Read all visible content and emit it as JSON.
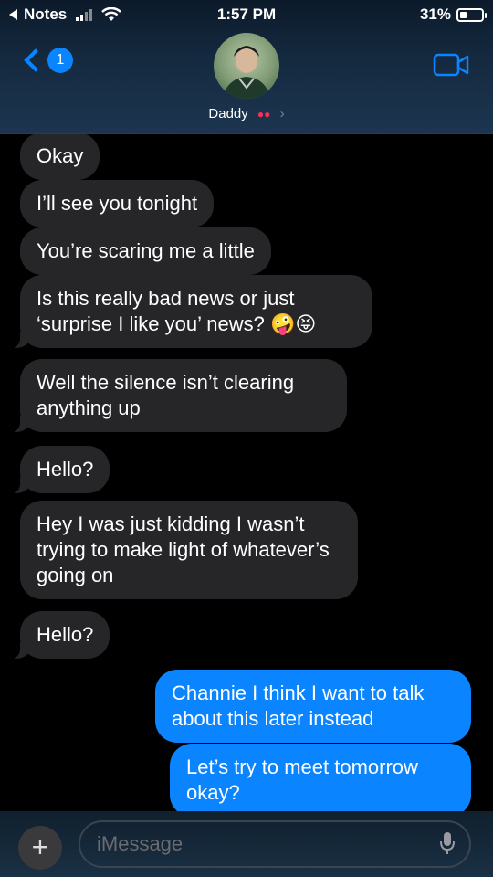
{
  "status_bar": {
    "back_app": "Notes",
    "time": "1:57 PM",
    "battery": "31%",
    "battery_level": 0.31
  },
  "header": {
    "back_badge": "1",
    "contact_name": "Daddy",
    "contact_emoji": "lips",
    "more_icon": "chevron-right-icon"
  },
  "messages": [
    {
      "dir": "in",
      "text": "Okay"
    },
    {
      "dir": "in",
      "text": "I’ll see you tonight"
    },
    {
      "dir": "in",
      "text": "You’re scaring me a little"
    },
    {
      "dir": "in",
      "text": "Is this really bad news or just ‘surprise I like you’ news? 🤪😝"
    },
    {
      "dir": "in",
      "text": "Well the silence isn’t clearing anything up"
    },
    {
      "dir": "in",
      "text": "Hello?"
    },
    {
      "dir": "in",
      "text": "Hey I was just kidding I wasn’t trying to make light of whatever’s going on"
    },
    {
      "dir": "in",
      "text": "Hello?"
    },
    {
      "dir": "out",
      "text": "Channie I think I want to talk about this later instead"
    },
    {
      "dir": "out",
      "text": "Let’s try to meet tomorrow okay?"
    }
  ],
  "input": {
    "placeholder": "iMessage"
  },
  "colors": {
    "accent": "#0a84ff",
    "incoming_bubble": "#262628",
    "outgoing_bubble": "#0a84ff"
  }
}
